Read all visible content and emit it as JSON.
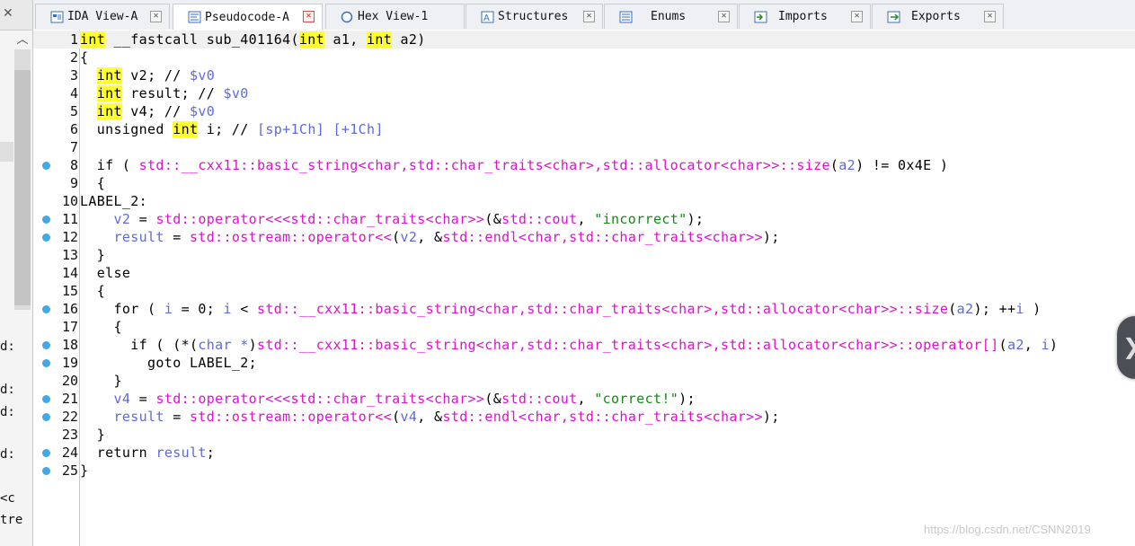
{
  "tabs": [
    {
      "label": "IDA View-A",
      "icon": "ida-view-icon",
      "active": false
    },
    {
      "label": "Pseudocode-A",
      "icon": "pseudocode-icon",
      "active": true
    },
    {
      "label": "Hex View-1",
      "icon": "hex-view-icon",
      "active": false
    },
    {
      "label": "Structures",
      "icon": "structures-icon",
      "active": false
    },
    {
      "label": "Enums",
      "icon": "enums-icon",
      "active": false
    },
    {
      "label": "Imports",
      "icon": "imports-icon",
      "active": false
    },
    {
      "label": "Exports",
      "icon": "exports-icon",
      "active": false
    }
  ],
  "left_pane_fragments": [
    "d:",
    "d:",
    "d:",
    "d:",
    "<c",
    "tre"
  ],
  "code_lines": [
    {
      "n": "1",
      "bp": false,
      "segs": [
        [
          "int",
          "kw hl"
        ],
        [
          " __fastcall sub_401164(",
          "kw"
        ],
        [
          "int",
          "kw hl"
        ],
        [
          " a1, ",
          "kw"
        ],
        [
          "int",
          "kw hl"
        ],
        [
          " a2)",
          "kw"
        ]
      ]
    },
    {
      "n": "2",
      "bp": false,
      "segs": [
        [
          "{",
          "kw"
        ]
      ]
    },
    {
      "n": "3",
      "bp": false,
      "segs": [
        [
          "  ",
          ""
        ],
        [
          "int",
          "kw hl"
        ],
        [
          " v2; // ",
          "kw"
        ],
        [
          "$v0",
          "com"
        ]
      ]
    },
    {
      "n": "4",
      "bp": false,
      "segs": [
        [
          "  ",
          ""
        ],
        [
          "int",
          "kw hl"
        ],
        [
          " result; // ",
          "kw"
        ],
        [
          "$v0",
          "com"
        ]
      ]
    },
    {
      "n": "5",
      "bp": false,
      "segs": [
        [
          "  ",
          ""
        ],
        [
          "int",
          "kw hl"
        ],
        [
          " v4; // ",
          "kw"
        ],
        [
          "$v0",
          "com"
        ]
      ]
    },
    {
      "n": "6",
      "bp": false,
      "segs": [
        [
          "  unsigned ",
          "kw"
        ],
        [
          "int",
          "kw hl"
        ],
        [
          " i; // ",
          "kw"
        ],
        [
          "[sp+1Ch] [+1Ch]",
          "com"
        ]
      ]
    },
    {
      "n": "7",
      "bp": false,
      "segs": []
    },
    {
      "n": "8",
      "bp": true,
      "segs": [
        [
          "  if ( ",
          "kw"
        ],
        [
          "std::__cxx11::basic_string<char,std::char_traits<char>,std::allocator<char>>::size",
          "fn"
        ],
        [
          "(",
          "kw"
        ],
        [
          "a2",
          "var"
        ],
        [
          ") != 0x4E )",
          "kw"
        ]
      ]
    },
    {
      "n": "9",
      "bp": false,
      "segs": [
        [
          "  {",
          "kw"
        ]
      ]
    },
    {
      "n": "10",
      "bp": false,
      "segs": [
        [
          "LABEL_2:",
          "kw"
        ]
      ]
    },
    {
      "n": "11",
      "bp": true,
      "segs": [
        [
          "    ",
          ""
        ],
        [
          "v2",
          "var"
        ],
        [
          " = ",
          "kw"
        ],
        [
          "std::operator<<<std::char_traits<char>>",
          "fn"
        ],
        [
          "(&",
          "kw"
        ],
        [
          "std::cout",
          "fn"
        ],
        [
          ", ",
          "kw"
        ],
        [
          "\"incorrect\"",
          "str"
        ],
        [
          ");",
          "kw"
        ]
      ]
    },
    {
      "n": "12",
      "bp": true,
      "segs": [
        [
          "    ",
          ""
        ],
        [
          "result",
          "var"
        ],
        [
          " = ",
          "kw"
        ],
        [
          "std::ostream::operator<<",
          "fn"
        ],
        [
          "(",
          "kw"
        ],
        [
          "v2",
          "var"
        ],
        [
          ", &",
          "kw"
        ],
        [
          "std::endl<char,std::char_traits<char>>",
          "fn"
        ],
        [
          ");",
          "kw"
        ]
      ]
    },
    {
      "n": "13",
      "bp": false,
      "segs": [
        [
          "  }",
          "kw"
        ]
      ]
    },
    {
      "n": "14",
      "bp": false,
      "segs": [
        [
          "  else",
          "kw"
        ]
      ]
    },
    {
      "n": "15",
      "bp": false,
      "segs": [
        [
          "  {",
          "kw"
        ]
      ]
    },
    {
      "n": "16",
      "bp": true,
      "segs": [
        [
          "    for ( ",
          "kw"
        ],
        [
          "i",
          "var"
        ],
        [
          " = 0; ",
          "kw"
        ],
        [
          "i",
          "var"
        ],
        [
          " < ",
          "kw"
        ],
        [
          "std::__cxx11::basic_string<char,std::char_traits<char>,std::allocator<char>>::size",
          "fn"
        ],
        [
          "(",
          "kw"
        ],
        [
          "a2",
          "var"
        ],
        [
          "); ++",
          "kw"
        ],
        [
          "i",
          "var"
        ],
        [
          " )",
          "kw"
        ]
      ]
    },
    {
      "n": "17",
      "bp": false,
      "segs": [
        [
          "    {",
          "kw"
        ]
      ]
    },
    {
      "n": "18",
      "bp": true,
      "segs": [
        [
          "      if ( (*(",
          "kw"
        ],
        [
          "char *",
          "var"
        ],
        [
          ")",
          "kw"
        ],
        [
          "std::__cxx11::basic_string<char,std::char_traits<char>,std::allocator<char>>::operator[]",
          "fn"
        ],
        [
          "(",
          "kw"
        ],
        [
          "a2",
          "var"
        ],
        [
          ", ",
          "kw"
        ],
        [
          "i",
          "var"
        ],
        [
          ")",
          "kw"
        ]
      ]
    },
    {
      "n": "19",
      "bp": true,
      "segs": [
        [
          "        goto LABEL_2;",
          "kw"
        ]
      ]
    },
    {
      "n": "20",
      "bp": false,
      "segs": [
        [
          "    }",
          "kw"
        ]
      ]
    },
    {
      "n": "21",
      "bp": true,
      "segs": [
        [
          "    ",
          ""
        ],
        [
          "v4",
          "var"
        ],
        [
          " = ",
          "kw"
        ],
        [
          "std::operator<<<std::char_traits<char>>",
          "fn"
        ],
        [
          "(&",
          "kw"
        ],
        [
          "std::cout",
          "fn"
        ],
        [
          ", ",
          "kw"
        ],
        [
          "\"correct!\"",
          "str"
        ],
        [
          ");",
          "kw"
        ]
      ]
    },
    {
      "n": "22",
      "bp": true,
      "segs": [
        [
          "    ",
          ""
        ],
        [
          "result",
          "var"
        ],
        [
          " = ",
          "kw"
        ],
        [
          "std::ostream::operator<<",
          "fn"
        ],
        [
          "(",
          "kw"
        ],
        [
          "v4",
          "var"
        ],
        [
          ", &",
          "kw"
        ],
        [
          "std::endl<char,std::char_traits<char>>",
          "fn"
        ],
        [
          ");",
          "kw"
        ]
      ]
    },
    {
      "n": "23",
      "bp": false,
      "segs": [
        [
          "  }",
          "kw"
        ]
      ]
    },
    {
      "n": "24",
      "bp": true,
      "segs": [
        [
          "  return ",
          "kw"
        ],
        [
          "result",
          "var"
        ],
        [
          ";",
          "kw"
        ]
      ]
    },
    {
      "n": "25",
      "bp": true,
      "segs": [
        [
          "}",
          "kw"
        ]
      ]
    }
  ],
  "watermark": "https://blog.csdn.net/CSNN2019",
  "colors": {
    "keyword": "#000000",
    "function": "#e010d0",
    "variable": "#5e6ad6",
    "string": "#138a13",
    "highlight": "#ffff30",
    "breakpoint": "#43a7e8"
  }
}
